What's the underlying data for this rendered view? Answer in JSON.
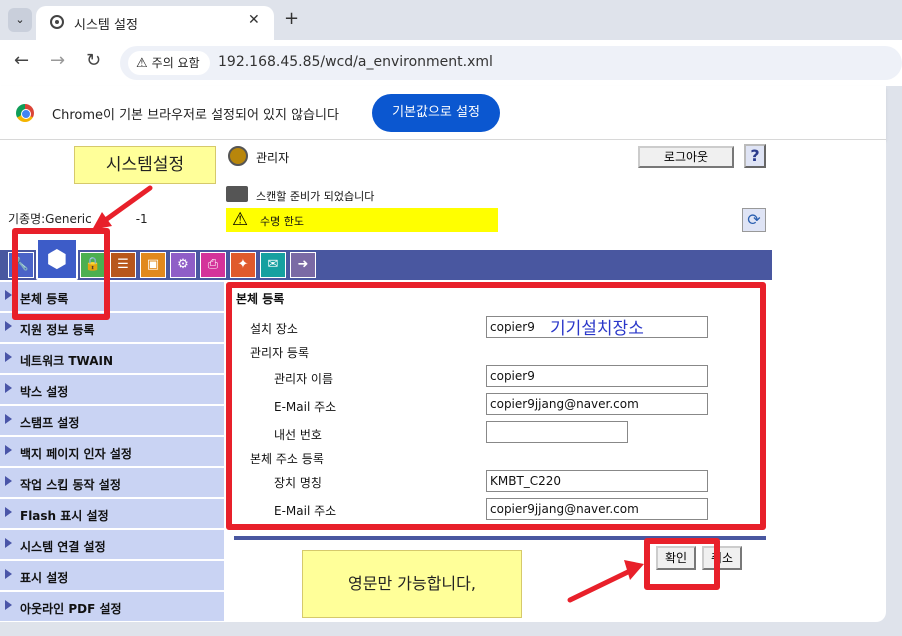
{
  "browser": {
    "tab_title": "시스템 설정",
    "tab_close": "✕",
    "new_tab": "+",
    "menu_glyph": "⌄",
    "warning_label": "주의 요함",
    "url": "192.168.45.85/wcd/a_environment.xml",
    "infobar_text": "Chrome이 기본 브라우저로 설정되어 있지 않습니다",
    "infobar_button": "기본값으로 설정",
    "icons": {
      "back": "arrow-left-icon",
      "forward": "arrow-right-icon",
      "reload": "reload-icon"
    }
  },
  "annotations": {
    "system_setting_label": "시스템설정",
    "handwritten_location": "기기설치장소",
    "english_only_note": "영문만 가능합니다,"
  },
  "header": {
    "model_label": "기종명:Generic",
    "model_suffix": "-1",
    "admin_label": "관리자",
    "logout_button": "로그아웃",
    "help_button": "?",
    "scan_status": "스캔할 준비가 되었습니다",
    "life_status": "수명 한도",
    "refresh_glyph": "⟳"
  },
  "sidebar": {
    "items": [
      {
        "label": "본체 등록"
      },
      {
        "label": "지원 정보 등록"
      },
      {
        "label": "네트워크 TWAIN"
      },
      {
        "label": "박스 설정"
      },
      {
        "label": "스탬프 설정"
      },
      {
        "label": "백지 페이지 인자 설정"
      },
      {
        "label": "작업 스킵 동작 설정"
      },
      {
        "label": "Flash 표시 설정"
      },
      {
        "label": "시스템 연결 설정"
      },
      {
        "label": "표시 설정"
      },
      {
        "label": "아웃라인 PDF 설정"
      }
    ]
  },
  "form": {
    "heading": "본체 등록",
    "install_location_label": "설치 장소",
    "install_location_value": "copier9",
    "admin_section": "관리자 등록",
    "admin_name_label": "관리자 이름",
    "admin_name_value": "copier9",
    "admin_email_label": "E-Mail 주소",
    "admin_email_value": "copier9jjang@naver.com",
    "extension_label": "내선 번호",
    "extension_value": "",
    "device_address_section": "본체 주소 등록",
    "device_name_label": "장치 명칭",
    "device_name_value": "KMBT_C220",
    "device_email_label": "E-Mail 주소",
    "device_email_value": "copier9jjang@naver.com"
  },
  "actions": {
    "ok_button": "확인",
    "cancel_button": "취소"
  }
}
